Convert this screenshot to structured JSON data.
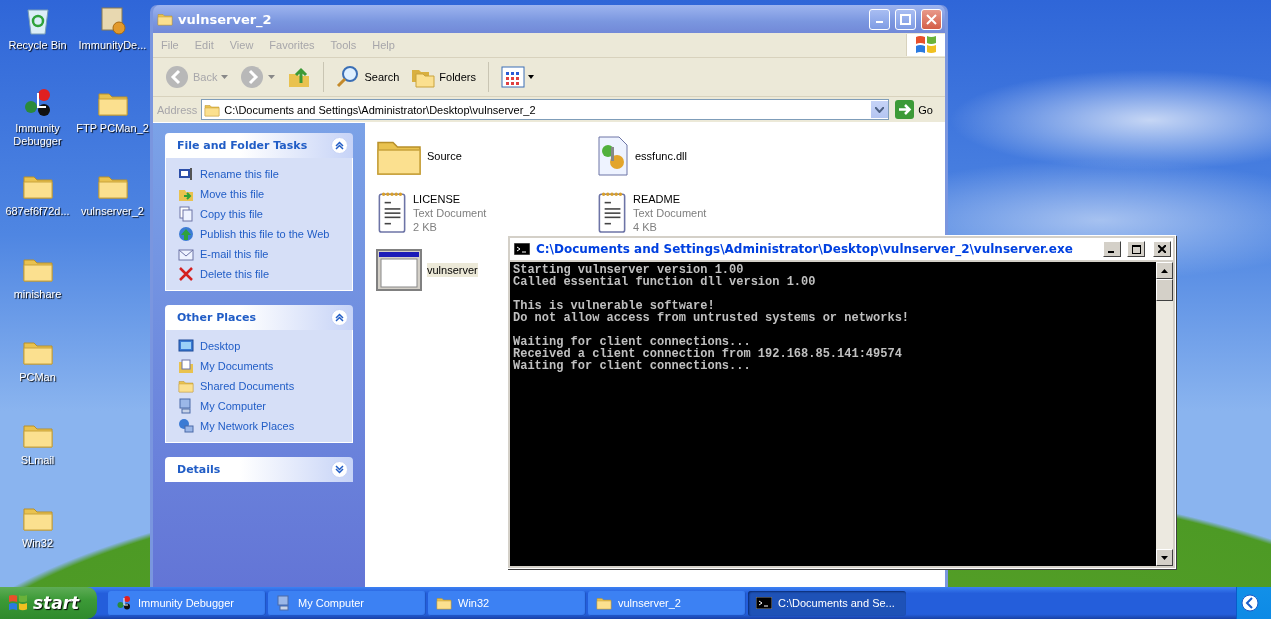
{
  "desktop_icons": {
    "columns": [
      [
        {
          "label": "Recycle Bin",
          "kind": "recycle"
        },
        {
          "label": "Immunity Debugger",
          "kind": "debugger"
        },
        {
          "label": "687ef6f72d...",
          "kind": "folder"
        },
        {
          "label": "minishare",
          "kind": "folder"
        },
        {
          "label": "PCMan",
          "kind": "folder"
        },
        {
          "label": "SLmail",
          "kind": "folder"
        },
        {
          "label": "Win32",
          "kind": "folder"
        }
      ],
      [
        {
          "label": "ImmunityDe...",
          "kind": "installer"
        },
        {
          "label": "FTP PCMan_2",
          "kind": "folder"
        },
        {
          "label": "vulnserver_2",
          "kind": "folder"
        }
      ]
    ]
  },
  "explorer": {
    "title": "vulnserver_2",
    "menu": [
      "File",
      "Edit",
      "View",
      "Favorites",
      "Tools",
      "Help"
    ],
    "toolbar": [
      {
        "label": "Back",
        "kind": "back",
        "disabled": true
      },
      {
        "kind": "forward",
        "disabled": true
      },
      {
        "kind": "up",
        "disabled": false
      },
      {
        "label": "Search",
        "kind": "search",
        "disabled": false
      },
      {
        "label": "Folders",
        "kind": "folders",
        "disabled": false
      },
      {
        "kind": "views",
        "disabled": false
      }
    ],
    "address": {
      "label": "Address",
      "value": "C:\\Documents and Settings\\Administrator\\Desktop\\vulnserver_2",
      "go": "Go"
    },
    "panels": [
      {
        "title": "File and Folder Tasks",
        "expanded": true,
        "items": [
          {
            "label": "Rename this file",
            "kind": "rename"
          },
          {
            "label": "Move this file",
            "kind": "move"
          },
          {
            "label": "Copy this file",
            "kind": "copy"
          },
          {
            "label": "Publish this file to the Web",
            "kind": "publish"
          },
          {
            "label": "E-mail this file",
            "kind": "email"
          },
          {
            "label": "Delete this file",
            "kind": "delete"
          }
        ]
      },
      {
        "title": "Other Places",
        "expanded": true,
        "items": [
          {
            "label": "Desktop",
            "kind": "desktop"
          },
          {
            "label": "My Documents",
            "kind": "documents"
          },
          {
            "label": "Shared Documents",
            "kind": "folder"
          },
          {
            "label": "My Computer",
            "kind": "computer"
          },
          {
            "label": "My Network Places",
            "kind": "network"
          }
        ]
      },
      {
        "title": "Details",
        "expanded": false
      }
    ],
    "files": [
      {
        "name": "Source",
        "kind": "folder",
        "selected": false
      },
      {
        "name": "essfunc.dll",
        "kind": "dll",
        "selected": false
      },
      {
        "name": "LICENSE",
        "kind": "text",
        "type": "Text Document",
        "size": "2 KB",
        "selected": false
      },
      {
        "name": "README",
        "kind": "text",
        "type": "Text Document",
        "size": "4 KB",
        "selected": false
      },
      {
        "name": "vulnserver",
        "kind": "exe",
        "selected": true
      }
    ]
  },
  "console": {
    "title": "C:\\Documents and Settings\\Administrator\\Desktop\\vulnserver_2\\vulnserver.exe",
    "paragraphs": [
      [
        "Starting vulnserver version 1.00",
        "Called essential function dll version 1.00"
      ],
      [
        "This is vulnerable software!",
        "Do not allow access from untrusted systems or networks!"
      ],
      [
        "Waiting for client connections...",
        "Received a client connection from 192.168.85.141:49574",
        "Waiting for client connections..."
      ]
    ]
  },
  "taskbar": {
    "start": "start",
    "items": [
      {
        "label": "Immunity Debugger",
        "kind": "debugger",
        "selected": false
      },
      {
        "label": "My Computer",
        "kind": "computer",
        "selected": false
      },
      {
        "label": "Win32",
        "kind": "folder",
        "selected": false
      },
      {
        "label": "vulnserver_2",
        "kind": "folder",
        "selected": false
      },
      {
        "label": "C:\\Documents and Se...",
        "kind": "console",
        "selected": true
      }
    ]
  }
}
